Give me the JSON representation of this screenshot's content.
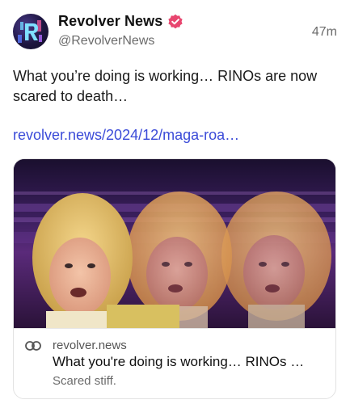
{
  "post": {
    "author_name": "Revolver News",
    "handle": "@RevolverNews",
    "timestamp": "47m",
    "text": "What you’re doing is working… RINOs are now scared to death…",
    "link": "revolver.news/2024/12/maga-roa…",
    "avatar_icon": "revolver-logo-icon",
    "verified_icon": "verified-badge-icon",
    "verified_color": "#e8466f"
  },
  "card": {
    "domain": "revolver.news",
    "title": "What you're doing is working… RINOs …",
    "description": "Scared stiff.",
    "link_icon": "link-icon",
    "image_alt": "photo-of-woman-repeated-three-times"
  },
  "colors": {
    "link": "#3b4bd8",
    "muted": "#6b6b6b",
    "text": "#111111",
    "image_background": "#2a1640"
  }
}
